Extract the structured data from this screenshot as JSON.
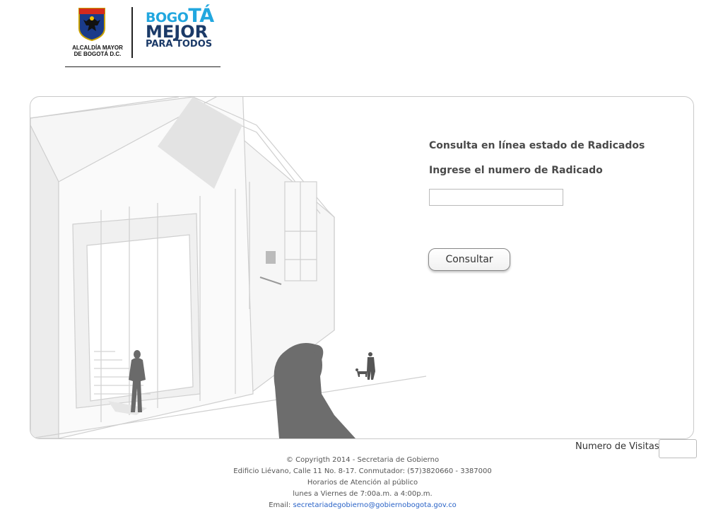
{
  "header": {
    "alcaldia_line1": "ALCALDÍA MAYOR",
    "alcaldia_line2": "DE BOGOTÁ D.C.",
    "brand_line1_small": "BOGO",
    "brand_line1_big": "TÁ",
    "brand_line2": "MEJOR",
    "brand_line3": "PARA TODOS",
    "crest_icon": "bogota-coat-of-arms-icon"
  },
  "form": {
    "title": "Consulta en línea estado de Radicados",
    "label": "Ingrese el numero de Radicado",
    "input_value": "",
    "button_label": "Consultar"
  },
  "visits": {
    "label": "Numero de Visitas:",
    "value": ""
  },
  "footer": {
    "copyright": "© Copyrigth 2014 - Secretaria de Gobierno",
    "address": "Edificio Liévano, Calle 11 No. 8-17. Conmutador: (57)3820660 - 3387000",
    "hours_title": "Horarios de Atención al público",
    "hours": "lunes a Viernes de 7:00a.m. a 4:00p.m.",
    "email_label": "Email:",
    "email": "secretariadegobierno@gobiernobogota.gov.co"
  },
  "colors": {
    "brand_blue": "#22a7df",
    "brand_navy": "#1b3a68",
    "link": "#2a63c7"
  }
}
